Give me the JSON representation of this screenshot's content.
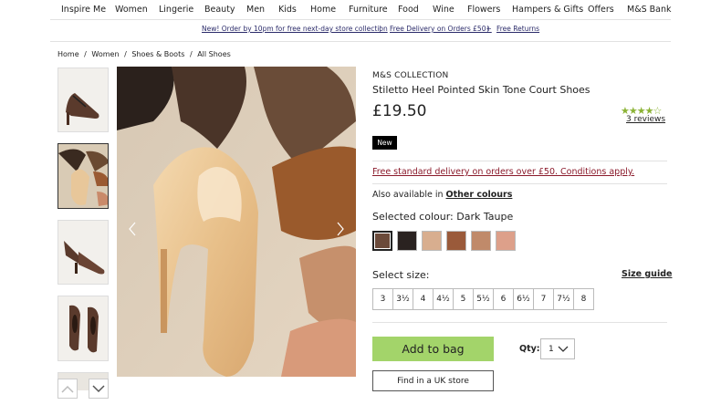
{
  "nav": {
    "items": [
      "Inspire Me",
      "Women",
      "Lingerie",
      "Beauty",
      "Men",
      "Kids",
      "Home",
      "Furniture",
      "Food",
      "Wine",
      "Flowers",
      "Hampers & Gifts",
      "Offers",
      "M&S Bank"
    ]
  },
  "promo": {
    "item1": "New! Order by 10pm for free next-day store collection",
    "sep": "|",
    "item2": "Free Delivery on Orders £50+",
    "item3": "Free Returns"
  },
  "breadcrumb": [
    "Home",
    "/",
    "Women",
    "/",
    "Shoes & Boots",
    "/",
    "All Shoes"
  ],
  "product": {
    "brand": "M&S COLLECTION",
    "title": "Stiletto Heel Pointed Skin Tone Court Shoes",
    "price": "£19.50",
    "rating_stars": "★★★★☆",
    "rating_value": 4,
    "reviews": "3 reviews",
    "badge": "New"
  },
  "delivery": "Free standard delivery on orders over £50. Conditions apply.",
  "also_available": {
    "text": "Also available in",
    "link": "Other colours"
  },
  "colour": {
    "label": "Selected colour: Dark Taupe",
    "swatches": [
      "#6b4a3a",
      "#2a2220",
      "#d8ae8f",
      "#9a5a3a",
      "#c08a6a",
      "#dda08a"
    ]
  },
  "size": {
    "label": "Select size:",
    "guide": "Size guide",
    "options": [
      "3",
      "3½",
      "4",
      "4½",
      "5",
      "5½",
      "6",
      "6½",
      "7",
      "7½",
      "8"
    ]
  },
  "buttons": {
    "add_to_bag": "Add to bag",
    "find_store": "Find in a UK store"
  },
  "qty": {
    "label": "Qty:",
    "value": "1"
  },
  "colors": {
    "accent_green": "#a3d46a",
    "delivery_red": "#8b1a2b",
    "stars_green": "#8cb336"
  }
}
